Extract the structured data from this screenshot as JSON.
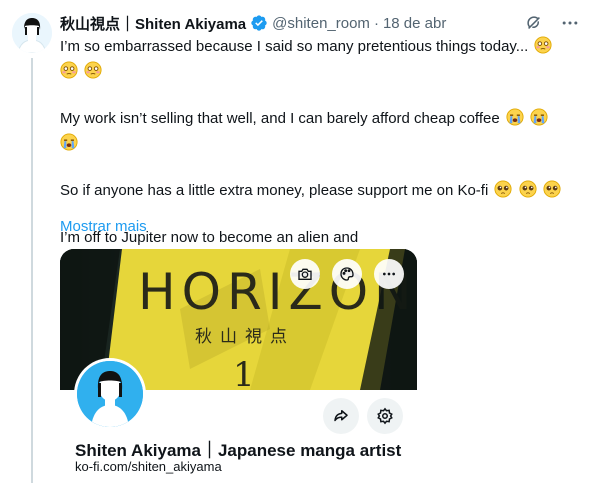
{
  "author": {
    "display_name": "秋山視点｜Shiten Akiyama",
    "handle": "@shiten_room",
    "separator": "·",
    "date": "18 de abr"
  },
  "tweet": {
    "line1": "I’m so embarrassed because I said so many pretentious things today...",
    "line2": "My work isn’t selling that well, and I can barely afford cheap coffee",
    "line3": "So if anyone has a little extra money, please support me on Ko-fi",
    "line4": "I’m off to Jupiter now to become an alien and",
    "show_more": "Mostrar mais"
  },
  "card": {
    "title": "Shiten Akiyama｜Japanese manga artist",
    "url": "ko-fi.com/shiten_akiyama",
    "banner_text": "HORIZON",
    "banner_subtitle": "秋山視点",
    "banner_number": "1"
  },
  "icons": {
    "verified": "verified-badge-icon",
    "grok": "grok-icon",
    "more": "more-icon",
    "camera": "camera-icon",
    "palette": "palette-icon",
    "ellipsis": "ellipsis-icon",
    "share": "share-icon",
    "settings": "settings-icon"
  },
  "colors": {
    "accent": "#1d9bf0",
    "text": "#0f1419",
    "secondary": "#536471",
    "banner_yellow": "#e8d93a"
  }
}
